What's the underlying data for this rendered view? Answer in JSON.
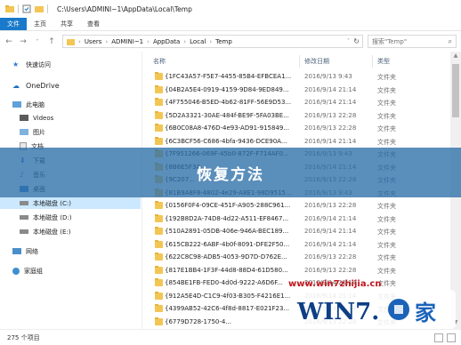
{
  "window": {
    "title": "C:\\Users\\ADMINI~1\\AppData\\Local\\Temp"
  },
  "ribbon": {
    "tabs": [
      "文件",
      "主页",
      "共享",
      "查看"
    ]
  },
  "address": {
    "crumbs": [
      "Users",
      "ADMINI~1",
      "AppData",
      "Local",
      "Temp"
    ],
    "search_placeholder": "搜索\"Temp\""
  },
  "sidebar": {
    "items": [
      {
        "label": "快速访问",
        "icon": "star-icon"
      },
      {
        "label": "OneDrive",
        "icon": "cloud-icon"
      },
      {
        "label": "此电脑",
        "icon": "computer-icon"
      },
      {
        "label": "Videos",
        "icon": "video-icon"
      },
      {
        "label": "图片",
        "icon": "picture-icon"
      },
      {
        "label": "文档",
        "icon": "document-icon"
      },
      {
        "label": "下载",
        "icon": "download-icon"
      },
      {
        "label": "音乐",
        "icon": "music-icon"
      },
      {
        "label": "桌面",
        "icon": "desktop-icon"
      },
      {
        "label": "本地磁盘 (C:)",
        "icon": "drive-icon"
      },
      {
        "label": "本地磁盘 (D:)",
        "icon": "drive-icon"
      },
      {
        "label": "本地磁盘 (E:)",
        "icon": "drive-icon"
      },
      {
        "label": "网络",
        "icon": "network-icon"
      },
      {
        "label": "家庭组",
        "icon": "homegroup-icon"
      }
    ]
  },
  "columns": {
    "name": "名称",
    "date": "修改日期",
    "type": "类型"
  },
  "files": [
    {
      "name": "{1FC43A57-F5E7-4455-85B4-EFBCEA1...",
      "date": "2016/9/13 9:43",
      "type": "文件夹"
    },
    {
      "name": "{04B2A5E4-0919-4159-9D84-9ED849...",
      "date": "2016/9/14 21:14",
      "type": "文件夹"
    },
    {
      "name": "{4F755046-B5ED-4b62-81FF-56E9D53...",
      "date": "2016/9/14 21:14",
      "type": "文件夹"
    },
    {
      "name": "{5D2A3321-30AE-484f-BE9F-5FA03BE...",
      "date": "2016/9/13 22:28",
      "type": "文件夹"
    },
    {
      "name": "{6B0C08A8-476D-4e93-AD91-915849...",
      "date": "2016/9/13 22:28",
      "type": "文件夹"
    },
    {
      "name": "{6C3BCF56-C686-4bfa-9436-DCE90A...",
      "date": "2016/9/14 21:14",
      "type": "文件夹"
    },
    {
      "name": "{7F951266-069F-45b0-872F-F714AF0...",
      "date": "2016/9/13 9:43",
      "type": "文件夹"
    },
    {
      "name": "{8B6E5F3A-...",
      "date": "2016/9/14 21:14",
      "type": "文件夹"
    },
    {
      "name": "{9C207...",
      "date": "2016/9/13 22:28",
      "type": "文件夹"
    },
    {
      "name": "{81B9A8F8-4802-4e29-A8E1-98D9515...",
      "date": "2016/9/13 9:43",
      "type": "文件夹"
    },
    {
      "name": "{0156F0F4-09CE-451F-A905-288C961...",
      "date": "2016/9/13 22:28",
      "type": "文件夹"
    },
    {
      "name": "{192B8D2A-74D8-4d22-A511-EF8467...",
      "date": "2016/9/14 21:14",
      "type": "文件夹"
    },
    {
      "name": "{510A2891-05DB-406e-946A-BEC189...",
      "date": "2016/9/14 21:14",
      "type": "文件夹"
    },
    {
      "name": "{615CB222-6ABF-4b0f-8091-DFE2F50...",
      "date": "2016/9/14 21:14",
      "type": "文件夹"
    },
    {
      "name": "{622C8C98-ADB5-4053-9D7D-D762E...",
      "date": "2016/9/13 22:28",
      "type": "文件夹"
    },
    {
      "name": "{817E1BB4-1F3F-44d8-88D4-61D580...",
      "date": "2016/9/13 22:28",
      "type": "文件夹"
    },
    {
      "name": "{854BE1FB-FED0-4d0d-9222-A6D6F...",
      "date": "2016/9/14 21:14",
      "type": "文件夹"
    },
    {
      "name": "{912A5E4D-C1C9-4f03-B305-F4216E1...",
      "date": "2016/9/14 21:14",
      "type": "文件夹"
    },
    {
      "name": "{4399AB52-42C6-4f8d-8817-E021F23...",
      "date": "2016/9/14 21:14",
      "type": "文件夹"
    },
    {
      "name": "{6779D728-1750-4...",
      "date": "2016/9/13 22:28",
      "type": "文件夹"
    }
  ],
  "status": {
    "count": "275 个项目"
  },
  "overlay": {
    "banner": "恢复方法",
    "watermark_url": "www.win7zhijia.cn",
    "logo": "WIN7.之家"
  },
  "colors": {
    "accent": "#1979ca",
    "folder": "#f3c654",
    "banner": "#2c6ea8",
    "watermark": "#c0161e"
  }
}
